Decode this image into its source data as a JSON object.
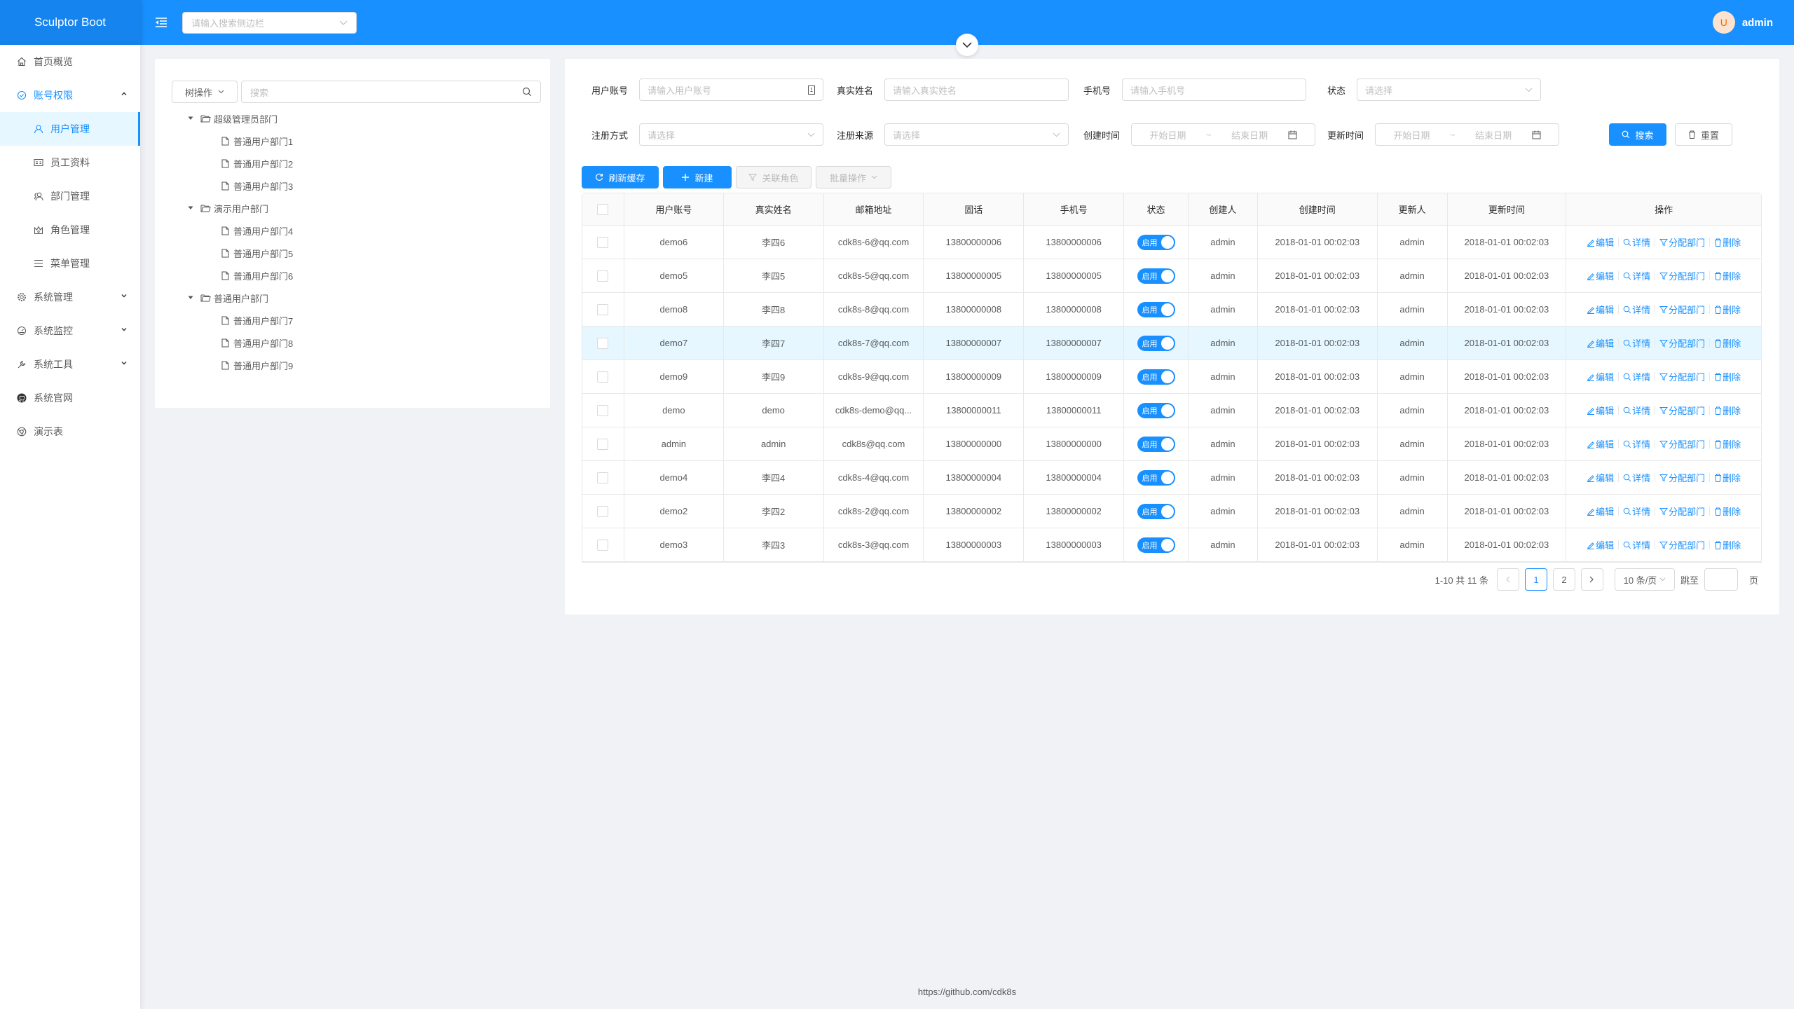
{
  "app": {
    "title": "Sculptor Boot"
  },
  "header": {
    "side_search_placeholder": "请输入搜索侧边栏",
    "avatar_letter": "U",
    "username": "admin"
  },
  "sidebar": {
    "items": [
      {
        "label": "首页概览",
        "icon": "home-icon"
      },
      {
        "label": "账号权限",
        "icon": "safety-icon",
        "expanded": true
      },
      {
        "label": "用户管理",
        "icon": "user-icon",
        "active": true
      },
      {
        "label": "员工资料",
        "icon": "idcard-icon"
      },
      {
        "label": "部门管理",
        "icon": "team-icon"
      },
      {
        "label": "角色管理",
        "icon": "crown-icon"
      },
      {
        "label": "菜单管理",
        "icon": "menu-icon"
      },
      {
        "label": "系统管理",
        "icon": "setting-icon"
      },
      {
        "label": "系统监控",
        "icon": "dashboard-icon"
      },
      {
        "label": "系统工具",
        "icon": "tool-icon"
      },
      {
        "label": "系统官网",
        "icon": "github-icon"
      },
      {
        "label": "演示表",
        "icon": "chrome-icon"
      }
    ]
  },
  "tree": {
    "op_label": "树操作",
    "search_placeholder": "搜索",
    "groups": [
      {
        "label": "超级管理员部门",
        "children": [
          "普通用户部门1",
          "普通用户部门2",
          "普通用户部门3"
        ]
      },
      {
        "label": "演示用户部门",
        "children": [
          "普通用户部门4",
          "普通用户部门5",
          "普通用户部门6"
        ]
      },
      {
        "label": "普通用户部门",
        "children": [
          "普通用户部门7",
          "普通用户部门8",
          "普通用户部门9"
        ]
      }
    ]
  },
  "form": {
    "username_label": "用户账号",
    "username_placeholder": "请输入用户账号",
    "realname_label": "真实姓名",
    "realname_placeholder": "请输入真实姓名",
    "phone_label": "手机号",
    "phone_placeholder": "请输入手机号",
    "status_label": "状态",
    "status_placeholder": "请选择",
    "regtype_label": "注册方式",
    "regtype_placeholder": "请选择",
    "regsource_label": "注册来源",
    "regsource_placeholder": "请选择",
    "created_label": "创建时间",
    "updated_label": "更新时间",
    "start_placeholder": "开始日期",
    "end_placeholder": "结束日期",
    "range_sep": "~",
    "search_btn": "搜索",
    "reset_btn": "重置"
  },
  "toolbar": {
    "refresh": "刷新缓存",
    "create": "新建",
    "link_role": "关联角色",
    "batch": "批量操作"
  },
  "table": {
    "headers": [
      "用户账号",
      "真实姓名",
      "邮箱地址",
      "固话",
      "手机号",
      "状态",
      "创建人",
      "创建时间",
      "更新人",
      "更新时间",
      "操作"
    ],
    "actions": {
      "edit": "编辑",
      "detail": "详情",
      "assign": "分配部门",
      "delete": "删除"
    },
    "status_on": "启用",
    "rows": [
      {
        "username": "demo6",
        "realname": "李四6",
        "email": "cdk8s-6@qq.com",
        "tel": "13800000006",
        "mobile": "13800000006",
        "creator": "admin",
        "created": "2018-01-01 00:02:03",
        "updater": "admin",
        "updated": "2018-01-01 00:02:03"
      },
      {
        "username": "demo5",
        "realname": "李四5",
        "email": "cdk8s-5@qq.com",
        "tel": "13800000005",
        "mobile": "13800000005",
        "creator": "admin",
        "created": "2018-01-01 00:02:03",
        "updater": "admin",
        "updated": "2018-01-01 00:02:03"
      },
      {
        "username": "demo8",
        "realname": "李四8",
        "email": "cdk8s-8@qq.com",
        "tel": "13800000008",
        "mobile": "13800000008",
        "creator": "admin",
        "created": "2018-01-01 00:02:03",
        "updater": "admin",
        "updated": "2018-01-01 00:02:03"
      },
      {
        "username": "demo7",
        "realname": "李四7",
        "email": "cdk8s-7@qq.com",
        "tel": "13800000007",
        "mobile": "13800000007",
        "creator": "admin",
        "created": "2018-01-01 00:02:03",
        "updater": "admin",
        "updated": "2018-01-01 00:02:03",
        "hover": true
      },
      {
        "username": "demo9",
        "realname": "李四9",
        "email": "cdk8s-9@qq.com",
        "tel": "13800000009",
        "mobile": "13800000009",
        "creator": "admin",
        "created": "2018-01-01 00:02:03",
        "updater": "admin",
        "updated": "2018-01-01 00:02:03"
      },
      {
        "username": "demo",
        "realname": "demo",
        "email": "cdk8s-demo@qq...",
        "tel": "13800000011",
        "mobile": "13800000011",
        "creator": "admin",
        "created": "2018-01-01 00:02:03",
        "updater": "admin",
        "updated": "2018-01-01 00:02:03"
      },
      {
        "username": "admin",
        "realname": "admin",
        "email": "cdk8s@qq.com",
        "tel": "13800000000",
        "mobile": "13800000000",
        "creator": "admin",
        "created": "2018-01-01 00:02:03",
        "updater": "admin",
        "updated": "2018-01-01 00:02:03"
      },
      {
        "username": "demo4",
        "realname": "李四4",
        "email": "cdk8s-4@qq.com",
        "tel": "13800000004",
        "mobile": "13800000004",
        "creator": "admin",
        "created": "2018-01-01 00:02:03",
        "updater": "admin",
        "updated": "2018-01-01 00:02:03"
      },
      {
        "username": "demo2",
        "realname": "李四2",
        "email": "cdk8s-2@qq.com",
        "tel": "13800000002",
        "mobile": "13800000002",
        "creator": "admin",
        "created": "2018-01-01 00:02:03",
        "updater": "admin",
        "updated": "2018-01-01 00:02:03"
      },
      {
        "username": "demo3",
        "realname": "李四3",
        "email": "cdk8s-3@qq.com",
        "tel": "13800000003",
        "mobile": "13800000003",
        "creator": "admin",
        "created": "2018-01-01 00:02:03",
        "updater": "admin",
        "updated": "2018-01-01 00:02:03"
      }
    ]
  },
  "pagination": {
    "summary": "1-10 共 11 条",
    "pages": [
      "1",
      "2"
    ],
    "current": "1",
    "page_size": "10 条/页",
    "jump_label": "跳至",
    "page_suffix": "页"
  },
  "footer": {
    "text": "https://github.com/cdk8s"
  },
  "colors": {
    "primary": "#1890ff",
    "avatar_bg": "#fde3cf",
    "avatar_fg": "#f56a00",
    "row_hover": "#e6f7ff"
  }
}
